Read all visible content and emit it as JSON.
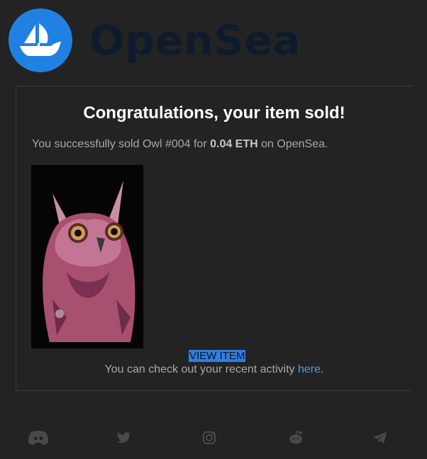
{
  "brand": {
    "name": "OpenSea",
    "color": "#2081e2"
  },
  "email": {
    "title": "Congratulations, your item sold!",
    "sold_prefix": "You successfully sold Owl #004 for ",
    "price": "0.04 ETH",
    "sold_suffix": " on OpenSea.",
    "view_item": "VIEW ITEM",
    "activity_prefix": "You can check out your recent activity ",
    "activity_link": "here",
    "activity_suffix": "."
  },
  "social_icons": [
    "discord-icon",
    "twitter-icon",
    "instagram-icon",
    "reddit-icon",
    "telegram-icon"
  ]
}
